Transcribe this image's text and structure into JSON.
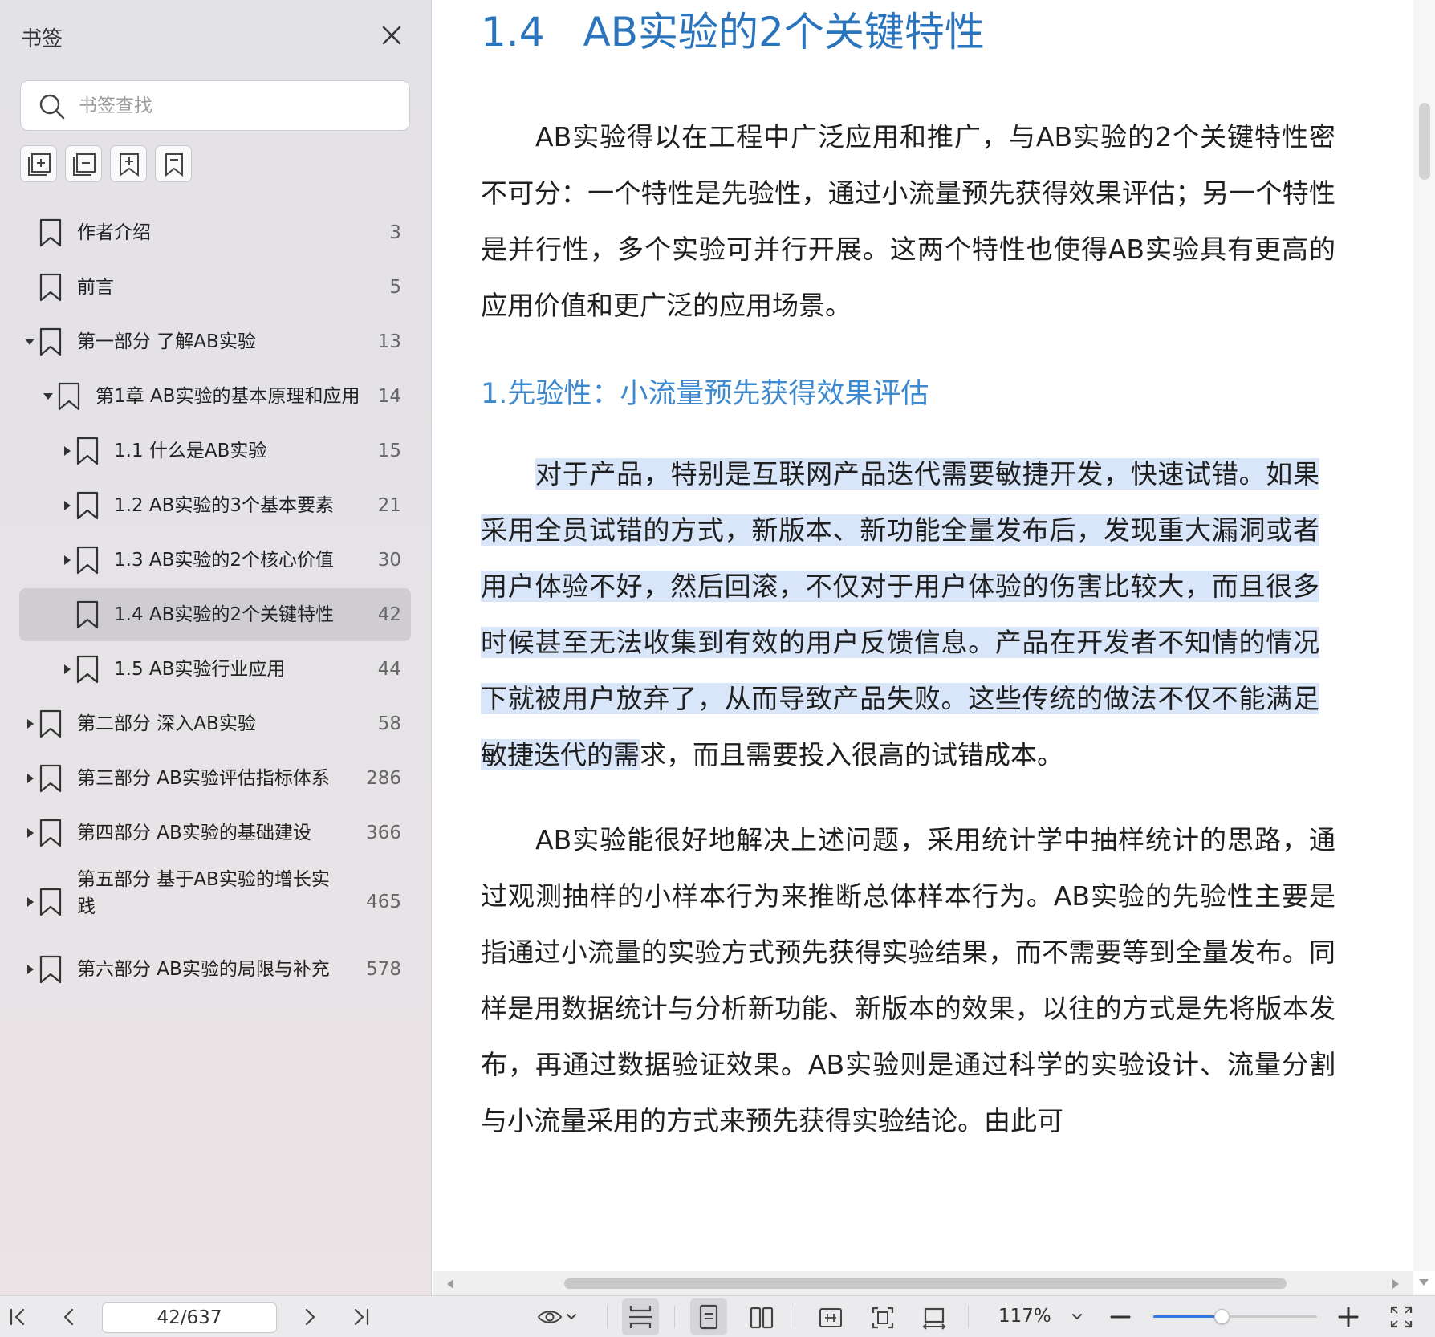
{
  "sidebar": {
    "title": "书签",
    "search_placeholder": "书签查找",
    "items": [
      {
        "label": "作者介绍",
        "page": "3",
        "level": 0,
        "arrow": "none",
        "active": false
      },
      {
        "label": "前言",
        "page": "5",
        "level": 0,
        "arrow": "none",
        "active": false
      },
      {
        "label": "第一部分 了解AB实验",
        "page": "13",
        "level": 0,
        "arrow": "expanded",
        "active": false
      },
      {
        "label": "第1章 AB实验的基本原理和应用",
        "page": "14",
        "level": 1,
        "arrow": "expanded",
        "active": false
      },
      {
        "label": "1.1 什么是AB实验",
        "page": "15",
        "level": 2,
        "arrow": "collapsed",
        "active": false
      },
      {
        "label": "1.2 AB实验的3个基本要素",
        "page": "21",
        "level": 2,
        "arrow": "collapsed",
        "active": false
      },
      {
        "label": "1.3 AB实验的2个核心价值",
        "page": "30",
        "level": 2,
        "arrow": "collapsed",
        "active": false
      },
      {
        "label": "1.4 AB实验的2个关键特性",
        "page": "42",
        "level": 2,
        "arrow": "none",
        "active": true
      },
      {
        "label": "1.5 AB实验行业应用",
        "page": "44",
        "level": 2,
        "arrow": "collapsed",
        "active": false
      },
      {
        "label": "第二部分 深入AB实验",
        "page": "58",
        "level": 0,
        "arrow": "collapsed",
        "active": false
      },
      {
        "label": "第三部分 AB实验评估指标体系",
        "page": "286",
        "level": 0,
        "arrow": "collapsed",
        "active": false
      },
      {
        "label": "第四部分 AB实验的基础建设",
        "page": "366",
        "level": 0,
        "arrow": "collapsed",
        "active": false
      },
      {
        "label": "第五部分 基于AB实验的增长实践",
        "page": "465",
        "level": 0,
        "arrow": "collapsed",
        "active": false
      },
      {
        "label": "第六部分 AB实验的局限与补充",
        "page": "578",
        "level": 0,
        "arrow": "collapsed",
        "active": false
      }
    ]
  },
  "document": {
    "heading_number": "1.4",
    "heading_title": "AB实验的2个关键特性",
    "para1": "AB实验得以在工程中广泛应用和推广，与AB实验的2个关键特性密不可分：一个特性是先验性，通过小流量预先获得效果评估；另一个特性是并行性，多个实验可并行开展。这两个特性也使得AB实验具有更高的应用价值和更广泛的应用场景。",
    "subheading": "1.先验性：小流量预先获得效果评估",
    "para2_highlighted": "对于产品，特别是互联网产品迭代需要敏捷开发，快速试错。如果采用全员试错的方式，新版本、新功能全量发布后，发现重大漏洞或者用户体验不好，然后回滚，不仅对于用户体验的伤害比较大，而且很多时候甚至无法收集到有效的用户反馈信息。产品在开发者不知情的情况下就被用户放弃了，从而导致产品失败。这些传统的做法不仅不能满足敏捷迭代的需",
    "para2_rest": "求，而且需要投入很高的试错成本。",
    "para3": "AB实验能很好地解决上述问题，采用统计学中抽样统计的思路，通过观测抽样的小样本行为来推断总体样本行为。AB实验的先验性主要是指通过小流量的实验方式预先获得实验结果，而不需要等到全量发布。同样是用数据统计与分析新功能、新版本的效果，以往的方式是先将版本发布，再通过数据验证效果。AB实验则是通过科学的实验设计、流量分割与小流量采用的方式来预先获得实验结论。由此可"
  },
  "toolbar": {
    "page_indicator": "42/637",
    "zoom": "117%",
    "zoom_level_fraction": 0.42
  },
  "colors": {
    "heading": "#2a74bd",
    "subheading": "#3d8ad0",
    "highlight": "#d9e6fa",
    "sidebar_bg": "#e3e2e6",
    "accent": "#2f7ae5"
  },
  "icons": {
    "close": "close-icon",
    "search": "search-icon",
    "bookmark": "bookmark-icon",
    "expand_all": "expand-all-icon",
    "collapse_all": "collapse-all-icon",
    "add_bookmark": "add-bookmark-icon",
    "bookmark_outline": "bookmark-outline-icon"
  }
}
